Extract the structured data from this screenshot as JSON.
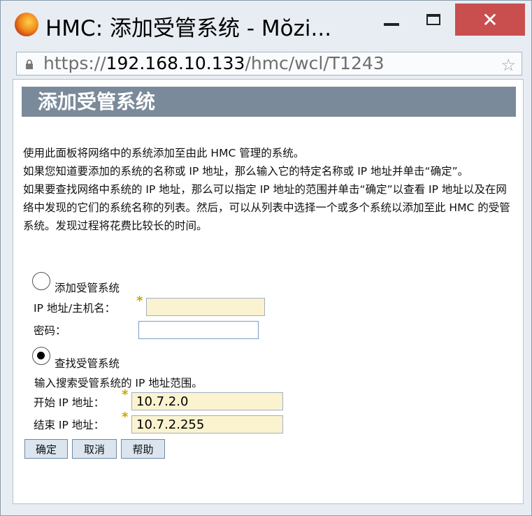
{
  "window": {
    "title": "HMC: 添加受管系统 - Mŏzi...",
    "icon": "firefox-icon",
    "controls": {
      "minimize": "minimize-icon",
      "maximize": "maximize-icon",
      "close": "✕"
    },
    "close_color": "#c94f4f"
  },
  "urlbar": {
    "protocol": "https://",
    "host": "192.168.10.133",
    "path": "/hmc/wcl/T1243"
  },
  "panel": {
    "header": "添加受管系统",
    "header_color": "#7a8a9a",
    "description": [
      "使用此面板将网络中的系统添加至由此 HMC 管理的系统。",
      "如果您知道要添加的系统的名称或 IP 地址，那么输入它的特定名称或 IP 地址并单击“确定”。",
      "如果要查找网络中系统的 IP 地址，那么可以指定 IP 地址的范围并单击“确定”以查看 IP 地址以及在网络中发现的它们的系统名称的列表。然后，可以从列表中选择一个或多个系统以添加至此 HMC 的受管系统。发现过程将花费比较长的时间。"
    ]
  },
  "form": {
    "add_option": {
      "label": "添加受管系统",
      "selected": false,
      "ip_label": "IP 地址/主机名：",
      "ip_value": "",
      "password_label": "密码：",
      "password_value": ""
    },
    "find_option": {
      "label": "查找受管系统",
      "selected": true,
      "hint": "输入搜索受管系统的 IP 地址范围。",
      "start_label": "开始 IP 地址：",
      "start_value": "10.7.2.0",
      "end_label": "结束 IP 地址：",
      "end_value": "10.7.2.255"
    },
    "required_marker": "*"
  },
  "buttons": {
    "ok": "确定",
    "cancel": "取消",
    "help": "帮助"
  }
}
